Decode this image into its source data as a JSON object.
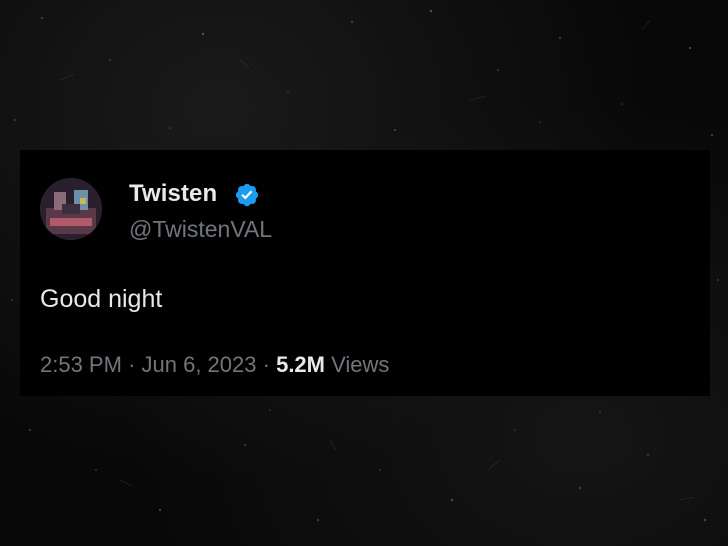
{
  "tweet": {
    "display_name": "Twisten",
    "handle": "@TwistenVAL",
    "verified_icon": "verified-badge-icon",
    "text": "Good night",
    "time": "2:53 PM",
    "separator": "·",
    "date": "Jun 6, 2023",
    "views_count": "5.2M",
    "views_label": "Views"
  },
  "colors": {
    "background": "#080808",
    "card": "#000000",
    "primary_text": "#e7e9ea",
    "secondary_text": "#71767b",
    "verified_blue": "#1d9bf0"
  }
}
